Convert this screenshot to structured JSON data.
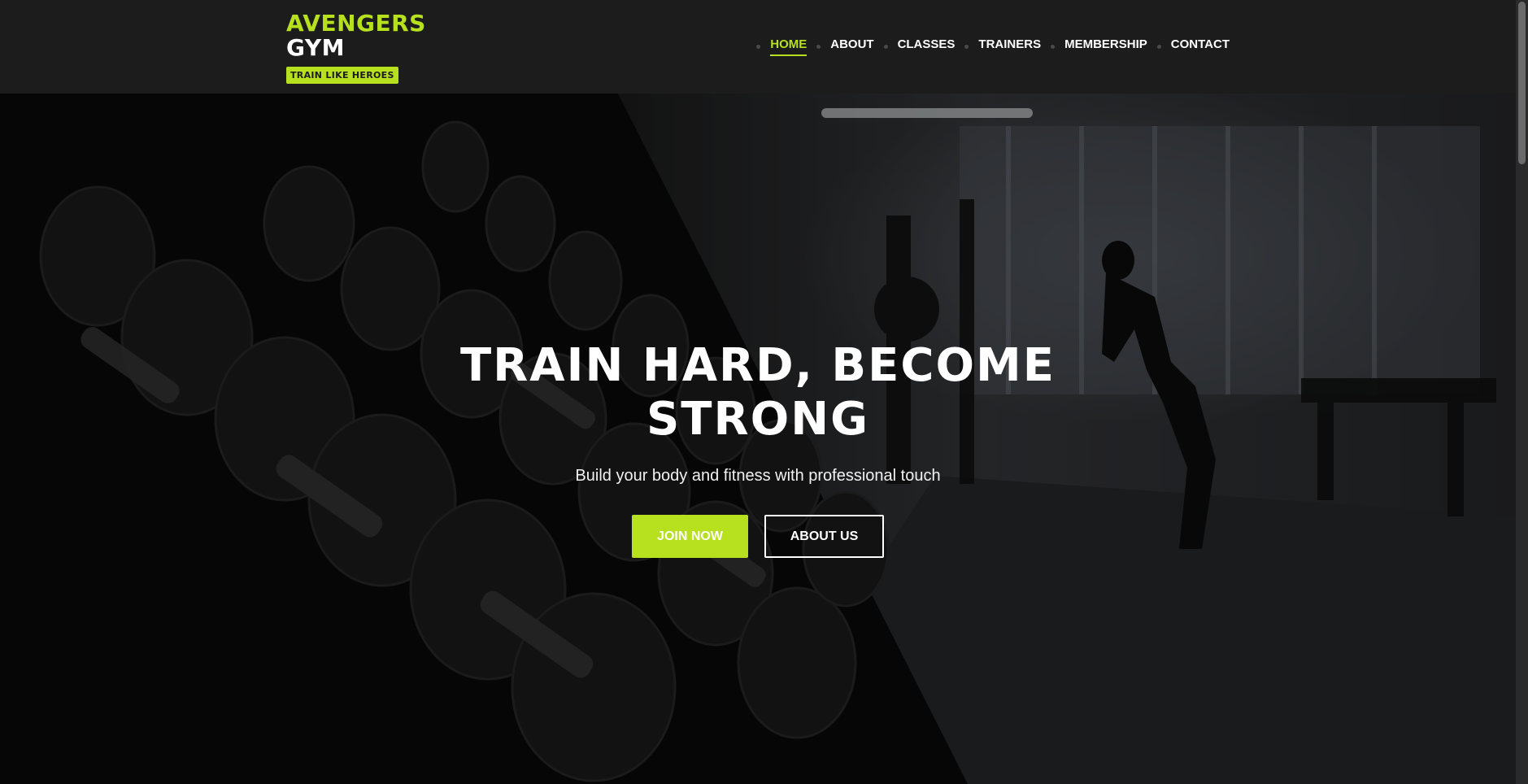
{
  "brand": {
    "line1": "AVENGERS",
    "line2": "GYM",
    "tagline": "TRAIN LIKE HEROES"
  },
  "nav": {
    "items": [
      {
        "label": "HOME",
        "active": true
      },
      {
        "label": "ABOUT",
        "active": false
      },
      {
        "label": "CLASSES",
        "active": false
      },
      {
        "label": "TRAINERS",
        "active": false
      },
      {
        "label": "MEMBERSHIP",
        "active": false
      },
      {
        "label": "CONTACT",
        "active": false
      }
    ]
  },
  "hero": {
    "title": "TRAIN HARD, BECOME STRONG",
    "subtitle": "Build your body and fitness with professional touch",
    "primary_button": "JOIN NOW",
    "secondary_button": "ABOUT US",
    "background_image": "gym-dumbbell-rack-photo"
  },
  "colors": {
    "accent": "#b7e01e",
    "header_bg": "#1c1c1c",
    "text": "#ffffff"
  }
}
